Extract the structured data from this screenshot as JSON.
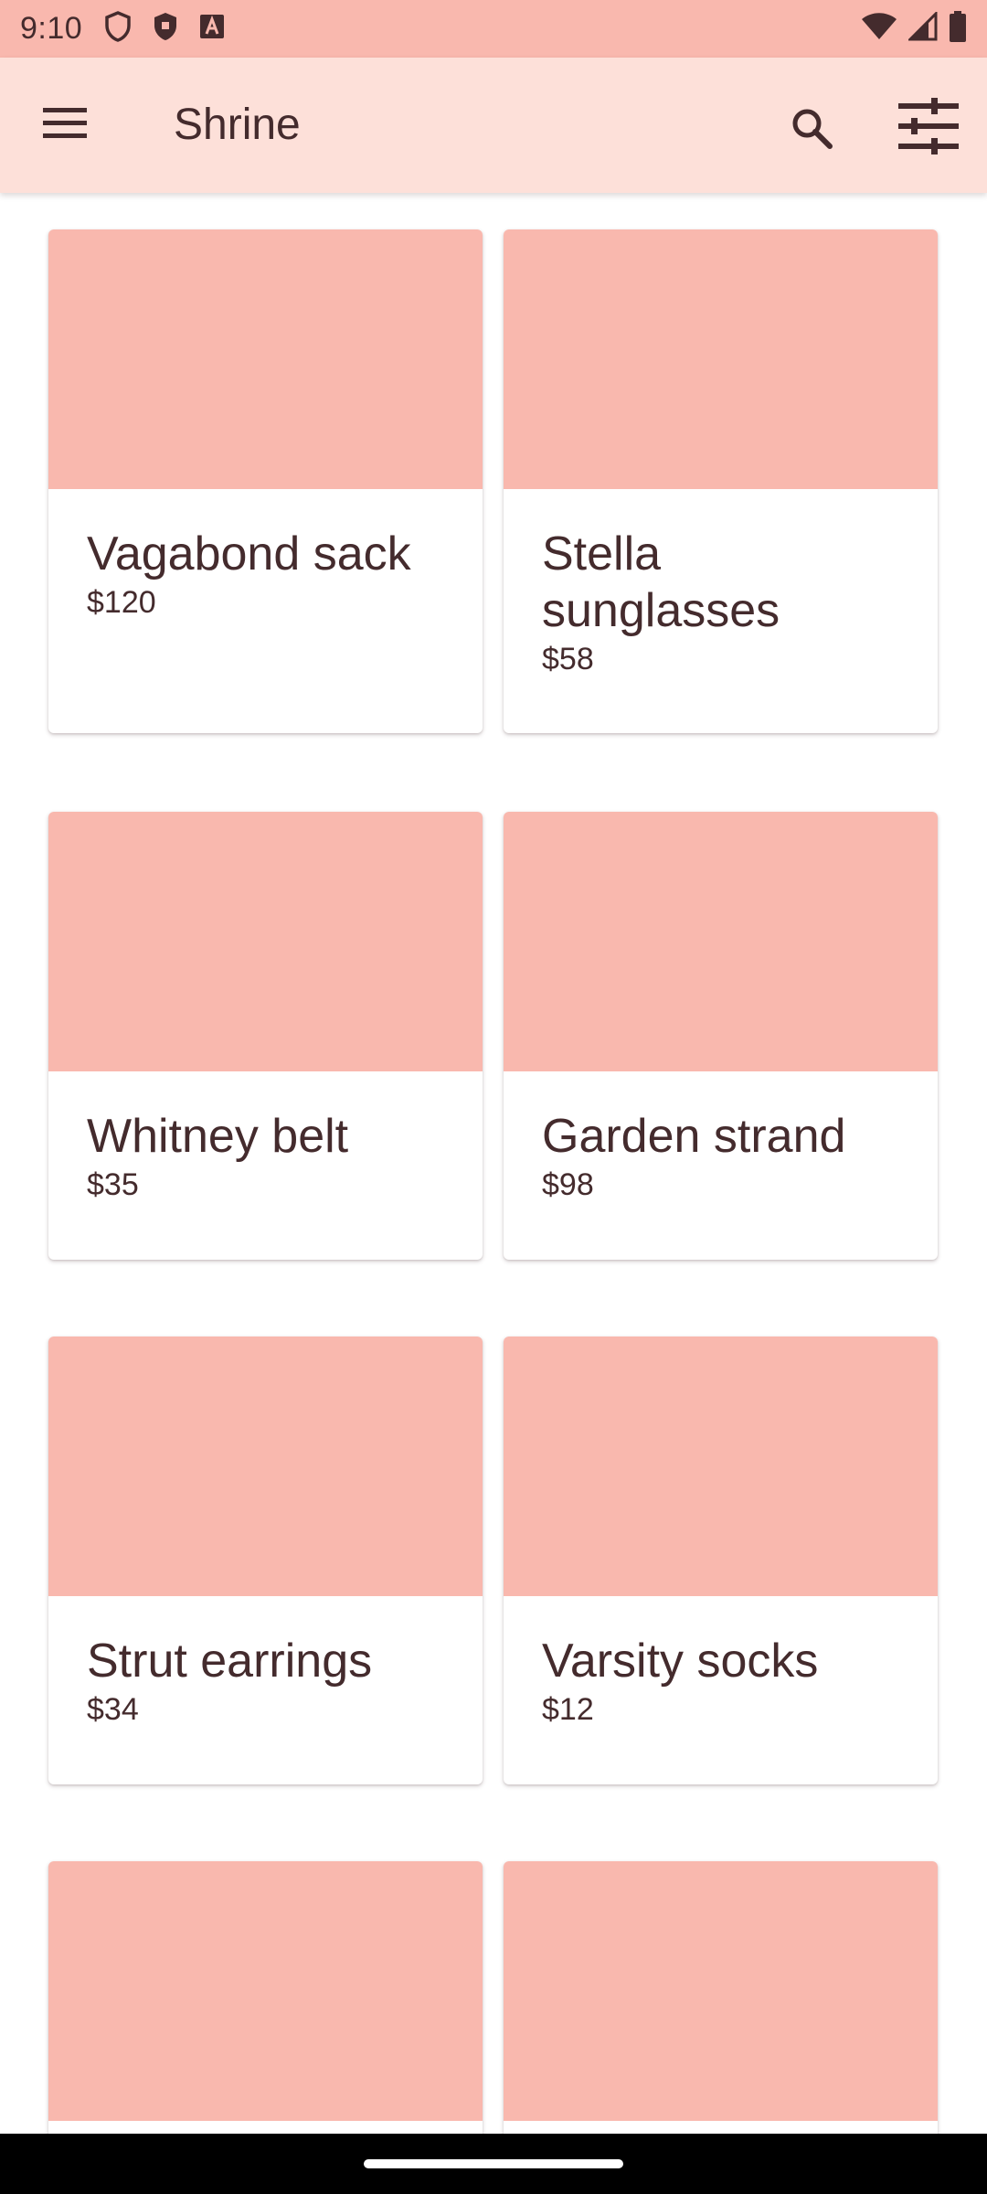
{
  "status_bar": {
    "time": "9:10",
    "left_icons": [
      "shield-outline-icon",
      "shield-filled-icon",
      "a-badge-icon"
    ],
    "right_icons": [
      "wifi-icon",
      "signal-icon",
      "battery-icon"
    ]
  },
  "app_bar": {
    "title": "Shrine",
    "icons": [
      "menu-icon",
      "search-icon",
      "tune-icon"
    ]
  },
  "products": [
    {
      "name": "Vagabond sack",
      "price": "$120"
    },
    {
      "name": "Stella sunglasses",
      "price": "$58"
    },
    {
      "name": "Whitney belt",
      "price": "$35"
    },
    {
      "name": "Garden strand",
      "price": "$98"
    },
    {
      "name": "Strut earrings",
      "price": "$34"
    },
    {
      "name": "Varsity socks",
      "price": "$12"
    },
    {
      "name": "",
      "price": ""
    },
    {
      "name": "",
      "price": ""
    }
  ],
  "colors": {
    "status_bar": "#f9b8ae",
    "app_bar": "#fde0d9",
    "image_placeholder": "#f9b8ae",
    "text": "#442b2d",
    "nav_bar": "#000000"
  }
}
